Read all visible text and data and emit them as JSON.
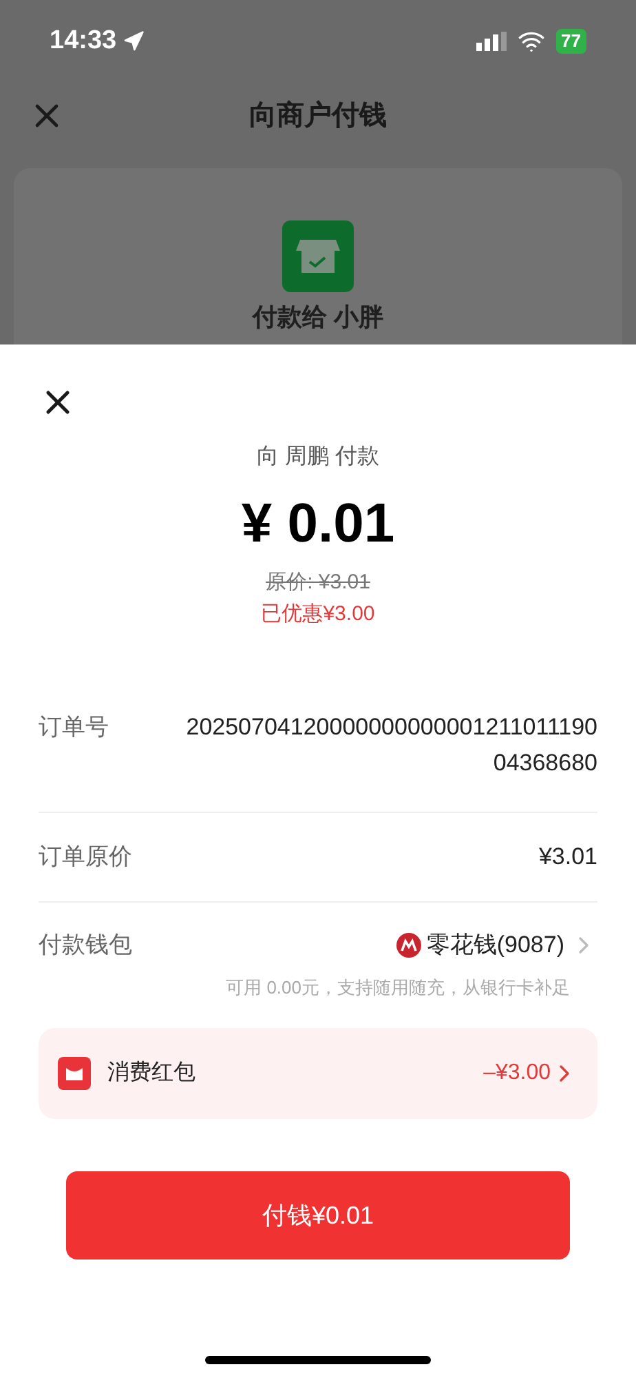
{
  "status_bar": {
    "time": "14:33",
    "battery": "77"
  },
  "nav": {
    "title": "向商户付钱"
  },
  "merchant_card": {
    "title": "付款给 小胖"
  },
  "sheet": {
    "payee": "向 周鹏 付款",
    "amount": "¥ 0.01",
    "original_price": "原价: ¥3.01",
    "discount": "已优惠¥3.00",
    "rows": [
      {
        "kind": "order",
        "label": "订单号",
        "value": "2025070412000000000000121101119004368680"
      },
      {
        "kind": "price",
        "label": "订单原价",
        "value": "¥3.01"
      },
      {
        "kind": "wallet",
        "label": "付款钱包",
        "value": "零花钱(9087)",
        "note": "可用 0.00元，支持随用随充，从银行卡补足"
      }
    ],
    "coupon": {
      "label": "消费红包",
      "value": "–¥3.00"
    },
    "pay_button": "付钱¥0.01"
  }
}
